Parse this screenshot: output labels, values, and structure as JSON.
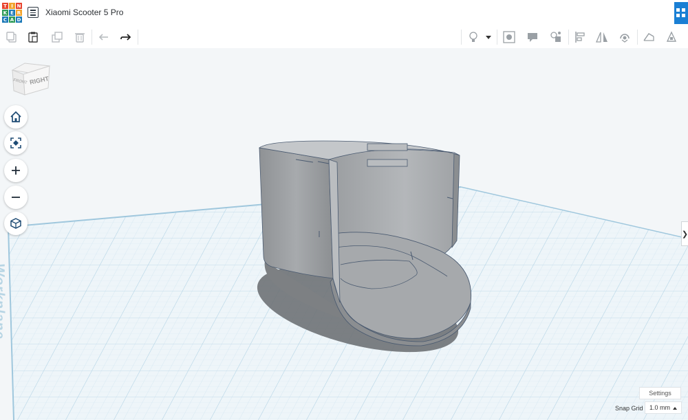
{
  "app": {
    "logo_letters": [
      "T",
      "I",
      "N",
      "K",
      "E",
      "R",
      "C",
      "A",
      "D"
    ],
    "title": "Xiaomi Scooter 5 Pro"
  },
  "toolbar": {
    "left_icons": [
      "copy-icon",
      "paste-icon",
      "duplicate-icon",
      "delete-icon",
      "undo-icon",
      "redo-icon"
    ],
    "right_icons": [
      "light-bulb-icon",
      "dropdown-caret-icon",
      "workplane-view-icon",
      "note-icon",
      "group-icon",
      "align-icon",
      "mirror-icon",
      "flip-icon",
      "export-icon",
      "send-to-icon"
    ]
  },
  "viewcube": {
    "front": "FRONT",
    "right": "RIGHT"
  },
  "nav": {
    "icons": [
      "home-icon",
      "fit-all-icon",
      "zoom-in-icon",
      "zoom-out-icon",
      "ortho-view-icon"
    ]
  },
  "workplane_label": "Workplane",
  "footer": {
    "settings_label": "Settings",
    "snap_label": "Snap Grid",
    "snap_value": "1.0 mm"
  },
  "colors": {
    "accent": "#1a7fd4",
    "model": "#9ea1a4",
    "grid": "#cfe3ee"
  }
}
